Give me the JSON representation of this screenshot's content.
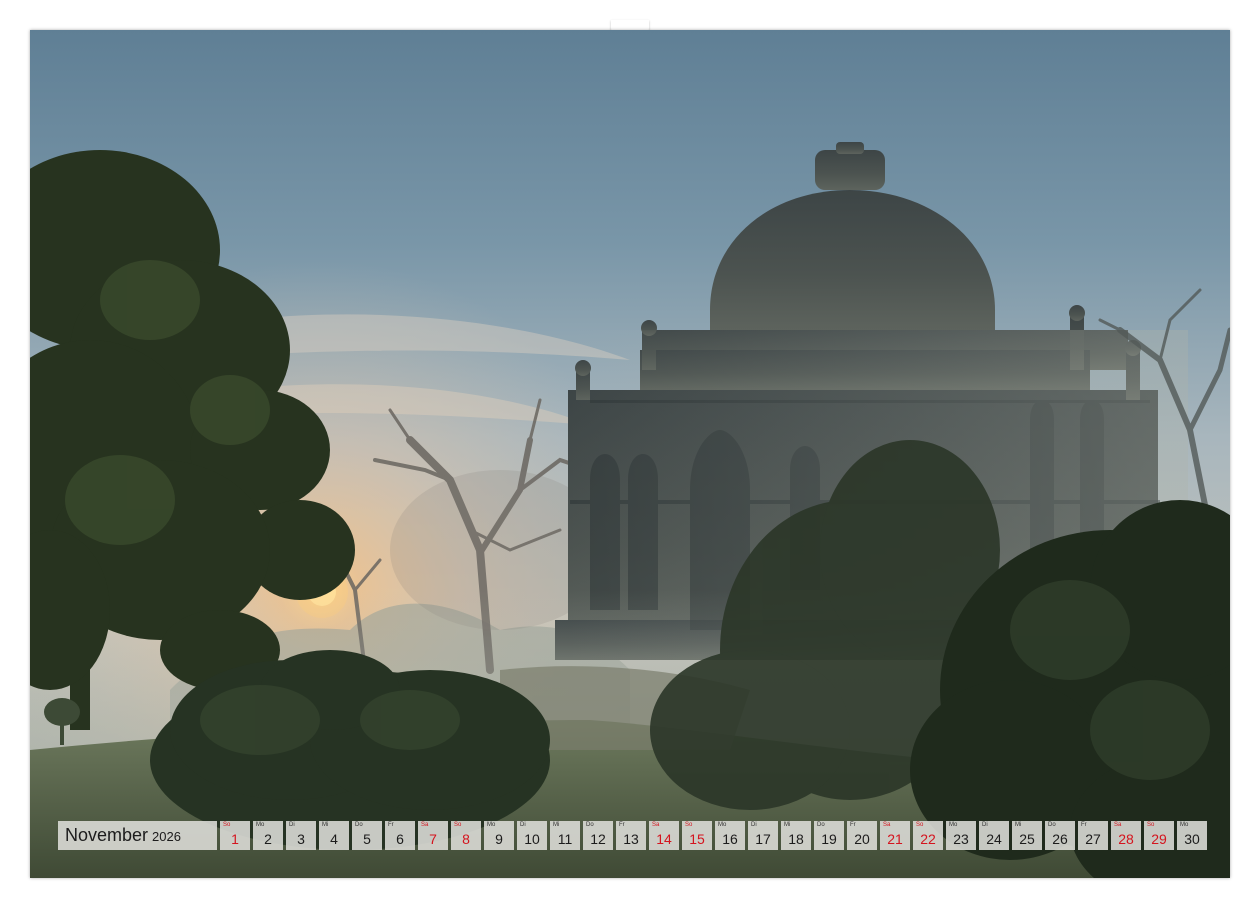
{
  "calendar": {
    "month": "November",
    "year": "2026",
    "weekend_color": "#d4141e",
    "days": [
      {
        "n": "1",
        "wd": "So",
        "we": true
      },
      {
        "n": "2",
        "wd": "Mo",
        "we": false
      },
      {
        "n": "3",
        "wd": "Di",
        "we": false
      },
      {
        "n": "4",
        "wd": "Mi",
        "we": false
      },
      {
        "n": "5",
        "wd": "Do",
        "we": false
      },
      {
        "n": "6",
        "wd": "Fr",
        "we": false
      },
      {
        "n": "7",
        "wd": "Sa",
        "we": true
      },
      {
        "n": "8",
        "wd": "So",
        "we": true
      },
      {
        "n": "9",
        "wd": "Mo",
        "we": false
      },
      {
        "n": "10",
        "wd": "Di",
        "we": false
      },
      {
        "n": "11",
        "wd": "Mi",
        "we": false
      },
      {
        "n": "12",
        "wd": "Do",
        "we": false
      },
      {
        "n": "13",
        "wd": "Fr",
        "we": false
      },
      {
        "n": "14",
        "wd": "Sa",
        "we": true
      },
      {
        "n": "15",
        "wd": "So",
        "we": true
      },
      {
        "n": "16",
        "wd": "Mo",
        "we": false
      },
      {
        "n": "17",
        "wd": "Di",
        "we": false
      },
      {
        "n": "18",
        "wd": "Mi",
        "we": false
      },
      {
        "n": "19",
        "wd": "Do",
        "we": false
      },
      {
        "n": "20",
        "wd": "Fr",
        "we": false
      },
      {
        "n": "21",
        "wd": "Sa",
        "we": true
      },
      {
        "n": "22",
        "wd": "So",
        "we": true
      },
      {
        "n": "23",
        "wd": "Mo",
        "we": false
      },
      {
        "n": "24",
        "wd": "Di",
        "we": false
      },
      {
        "n": "25",
        "wd": "Mi",
        "we": false
      },
      {
        "n": "26",
        "wd": "Do",
        "we": false
      },
      {
        "n": "27",
        "wd": "Fr",
        "we": false
      },
      {
        "n": "28",
        "wd": "Sa",
        "we": true
      },
      {
        "n": "29",
        "wd": "So",
        "we": true
      },
      {
        "n": "30",
        "wd": "Mo",
        "we": false
      }
    ]
  }
}
